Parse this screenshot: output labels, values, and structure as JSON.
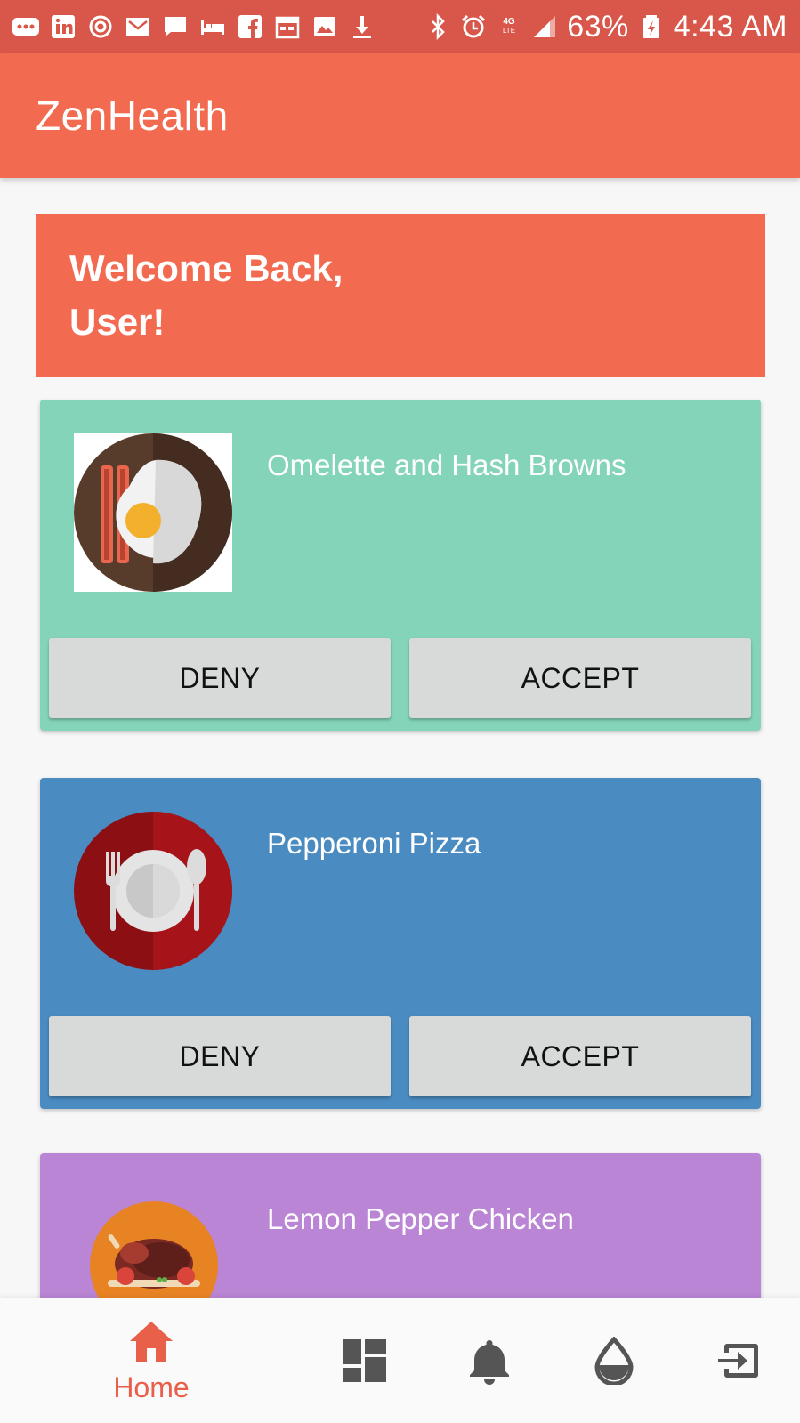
{
  "status_bar": {
    "battery": "63%",
    "time": "4:43 AM",
    "network": "4G LTE",
    "left_icons": [
      "more-icon",
      "linkedin-icon",
      "sync-icon",
      "mail-icon",
      "chat-icon",
      "hotel-icon",
      "facebook-icon",
      "calendar-icon",
      "image-icon",
      "download-icon"
    ],
    "right_icons": [
      "bluetooth-icon",
      "alarm-icon",
      "lte-icon",
      "signal-icon",
      "battery-icon"
    ]
  },
  "app_bar": {
    "title": "ZenHealth"
  },
  "welcome": {
    "text": "Welcome Back, User!"
  },
  "meals": [
    {
      "name": "Omelette and Hash Browns",
      "icon": "bacon-egg-icon",
      "color": "#84d4b9",
      "deny_label": "DENY",
      "accept_label": "ACCEPT"
    },
    {
      "name": "Pepperoni Pizza",
      "icon": "plate-cutlery-icon",
      "color": "#4a8bc1",
      "deny_label": "DENY",
      "accept_label": "ACCEPT"
    },
    {
      "name": "Lemon Pepper Chicken",
      "icon": "roast-chicken-icon",
      "color": "#b985d4"
    }
  ],
  "bottom_nav": {
    "items": [
      {
        "icon": "home-icon",
        "label": "Home",
        "active": true
      },
      {
        "icon": "dashboard-icon"
      },
      {
        "icon": "bell-icon"
      },
      {
        "icon": "water-drop-icon"
      },
      {
        "icon": "logout-icon"
      }
    ],
    "active_color": "#e8604a",
    "inactive_color": "#555555"
  },
  "colors": {
    "status_bar": "#d9574a",
    "primary": "#f26a4f",
    "background": "#f7f7f7"
  }
}
